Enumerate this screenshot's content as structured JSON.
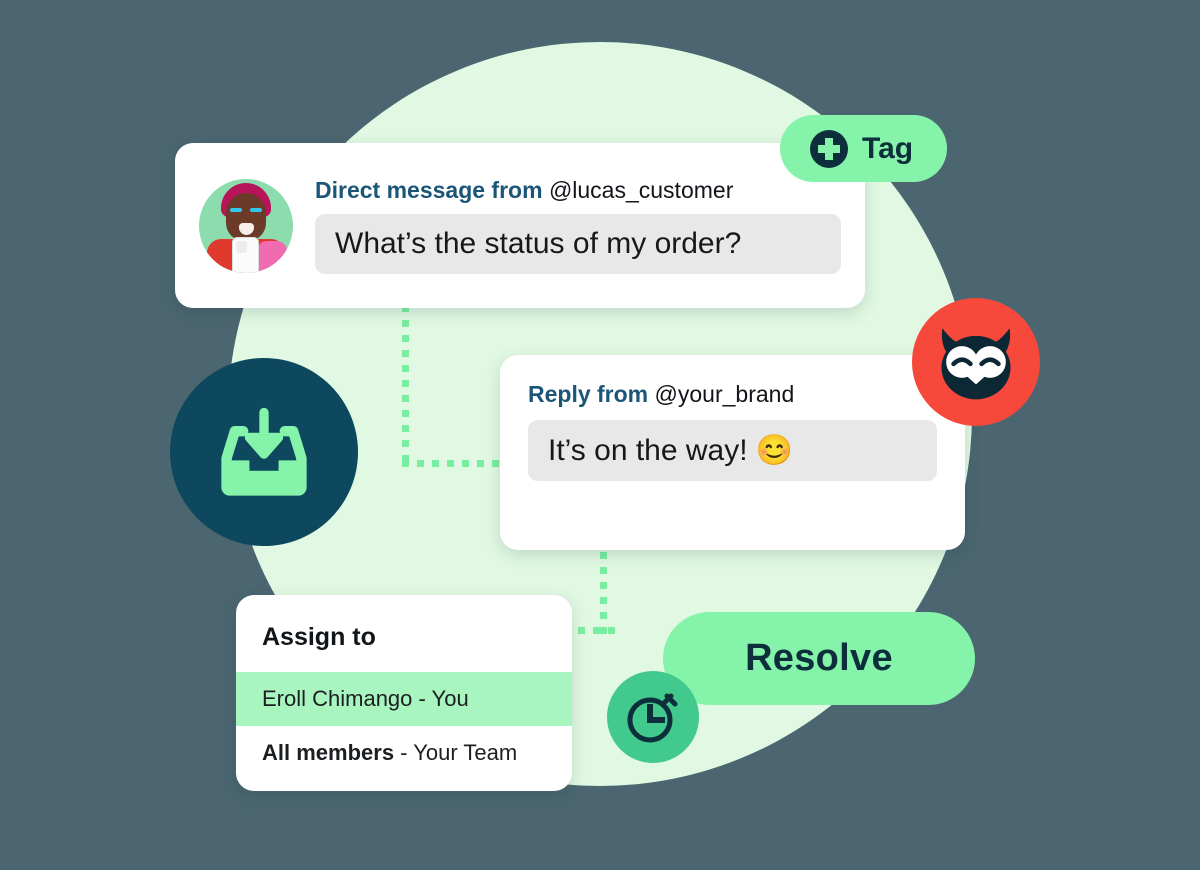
{
  "colors": {
    "page_background": "#4b6670",
    "bg_circle": "#e1f9e2",
    "accent_green": "#85f3a9",
    "highlight_green": "#a8f5c0",
    "dark_navy": "#0d2f3c",
    "inbox_circle": "#0d485e",
    "timer_circle": "#42c98e",
    "owl_circle": "#f6483b",
    "header_blue": "#1b5577",
    "bubble_gray": "#e8e8e8",
    "connector_green": "#7aeea0"
  },
  "direct_message_card": {
    "avatar_alt": "customer-avatar",
    "header_bold": "Direct message from",
    "header_handle": "@lucas_customer",
    "message_text": "What’s the status of my order?"
  },
  "reply_card": {
    "header_bold": "Reply from",
    "header_handle": "@your_brand",
    "message_text": "It’s on the way!",
    "message_emoji": "😊"
  },
  "assign_card": {
    "title": "Assign to",
    "rows": [
      {
        "name": "Eroll Chimango",
        "suffix": " - You",
        "active": true
      },
      {
        "name": "All members",
        "suffix": " - Your Team",
        "active": false
      }
    ]
  },
  "tag_button": {
    "label": "Tag",
    "icon": "plus-circle-icon"
  },
  "resolve_button": {
    "label": "Resolve"
  },
  "badges": {
    "inbox_icon": "inbox-download-icon",
    "timer_icon": "stopwatch-timer-icon",
    "brand_icon": "hootsuite-owl-icon"
  }
}
